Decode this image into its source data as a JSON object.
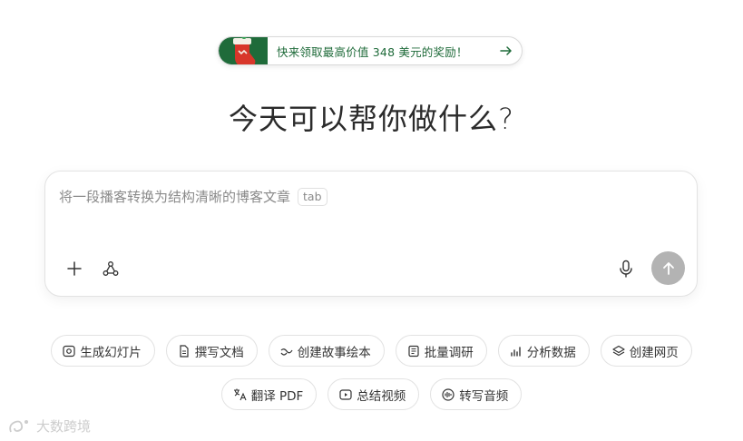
{
  "promo": {
    "text": "快来领取最高价值 348 美元的奖励！"
  },
  "title": "今天可以帮你做什么?",
  "input": {
    "placeholder": "将一段播客转换为结构清晰的博客文章",
    "tab_hint": "tab"
  },
  "chips_row1": [
    {
      "label": "生成幻灯片",
      "icon": "slides-icon"
    },
    {
      "label": "撰写文档",
      "icon": "document-icon"
    },
    {
      "label": "创建故事绘本",
      "icon": "story-icon"
    },
    {
      "label": "批量调研",
      "icon": "research-icon"
    },
    {
      "label": "分析数据",
      "icon": "chart-icon"
    },
    {
      "label": "创建网页",
      "icon": "layers-icon"
    }
  ],
  "chips_row2": [
    {
      "label": "翻译 PDF",
      "icon": "translate-icon"
    },
    {
      "label": "总结视频",
      "icon": "video-icon"
    },
    {
      "label": "转写音频",
      "icon": "audio-icon"
    }
  ],
  "watermark": {
    "text": "大数跨境"
  },
  "colors": {
    "accent_green": "#1f6b3a",
    "send_disabled": "#b3b3b3"
  }
}
